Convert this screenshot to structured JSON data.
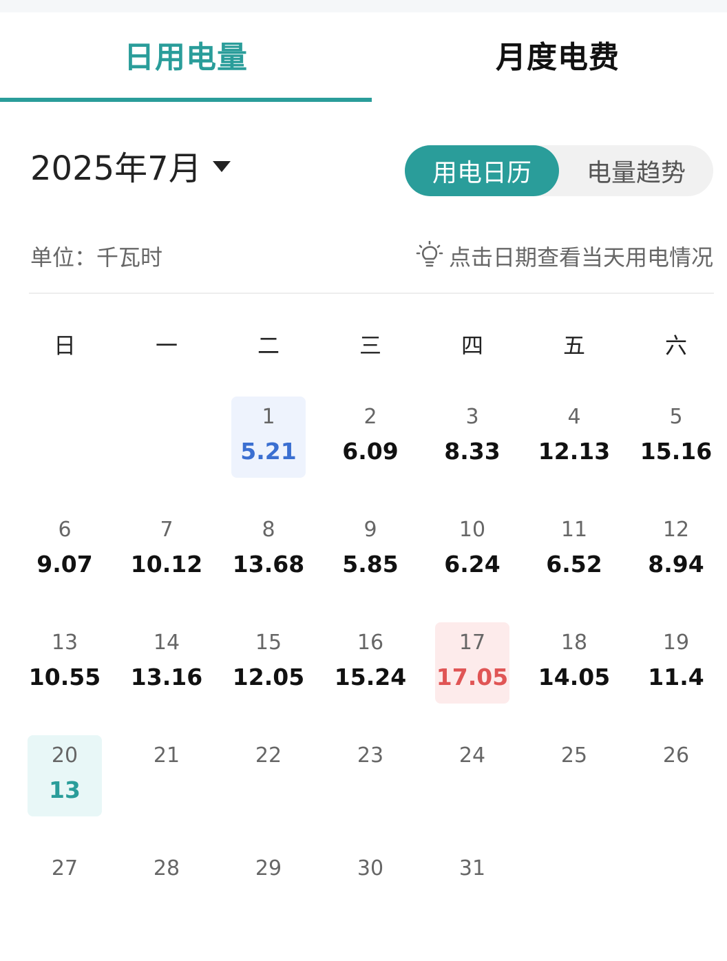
{
  "tabs": {
    "daily": "日用电量",
    "monthly": "月度电费"
  },
  "month_selector": {
    "label": "2025年7月"
  },
  "view_toggle": {
    "calendar": "用电日历",
    "trend": "电量趋势"
  },
  "unit": "单位：千瓦时",
  "hint": "点击日期查看当天用电情况",
  "weekdays": [
    "日",
    "一",
    "二",
    "三",
    "四",
    "五",
    "六"
  ],
  "calendar": {
    "first_weekday_index": 2,
    "days": [
      {
        "day": "1",
        "value": "5.21",
        "highlight": "blue"
      },
      {
        "day": "2",
        "value": "6.09"
      },
      {
        "day": "3",
        "value": "8.33"
      },
      {
        "day": "4",
        "value": "12.13"
      },
      {
        "day": "5",
        "value": "15.16"
      },
      {
        "day": "6",
        "value": "9.07"
      },
      {
        "day": "7",
        "value": "10.12"
      },
      {
        "day": "8",
        "value": "13.68"
      },
      {
        "day": "9",
        "value": "5.85"
      },
      {
        "day": "10",
        "value": "6.24"
      },
      {
        "day": "11",
        "value": "6.52"
      },
      {
        "day": "12",
        "value": "8.94"
      },
      {
        "day": "13",
        "value": "10.55"
      },
      {
        "day": "14",
        "value": "13.16"
      },
      {
        "day": "15",
        "value": "12.05"
      },
      {
        "day": "16",
        "value": "15.24"
      },
      {
        "day": "17",
        "value": "17.05",
        "highlight": "red"
      },
      {
        "day": "18",
        "value": "14.05"
      },
      {
        "day": "19",
        "value": "11.4"
      },
      {
        "day": "20",
        "value": "13",
        "highlight": "teal"
      },
      {
        "day": "21",
        "value": ""
      },
      {
        "day": "22",
        "value": ""
      },
      {
        "day": "23",
        "value": ""
      },
      {
        "day": "24",
        "value": ""
      },
      {
        "day": "25",
        "value": ""
      },
      {
        "day": "26",
        "value": ""
      },
      {
        "day": "27",
        "value": ""
      },
      {
        "day": "28",
        "value": ""
      },
      {
        "day": "29",
        "value": ""
      },
      {
        "day": "30",
        "value": ""
      },
      {
        "day": "31",
        "value": ""
      }
    ]
  },
  "colors": {
    "accent": "#2a9d9a",
    "highlight_blue": "#3b6fd1",
    "highlight_red": "#e05555"
  }
}
